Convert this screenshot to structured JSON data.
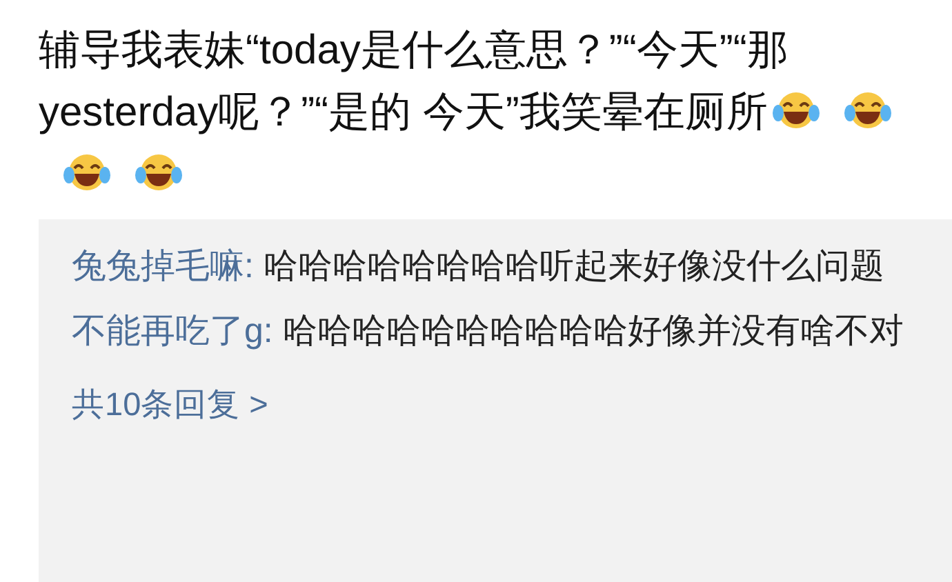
{
  "post": {
    "text": "辅导我表妹“today是什么意思？”“今天”“那yesterday呢？”“是的 今天”我笑晕在厕所"
  },
  "replies": [
    {
      "author": "兔兔掉毛嘛:",
      "text": "哈哈哈哈哈哈哈哈听起来好像没什么问题"
    },
    {
      "author": "不能再吃了g:",
      "text": "哈哈哈哈哈哈哈哈哈哈好像并没有啥不对"
    }
  ],
  "more_link": "共10条回复 >"
}
